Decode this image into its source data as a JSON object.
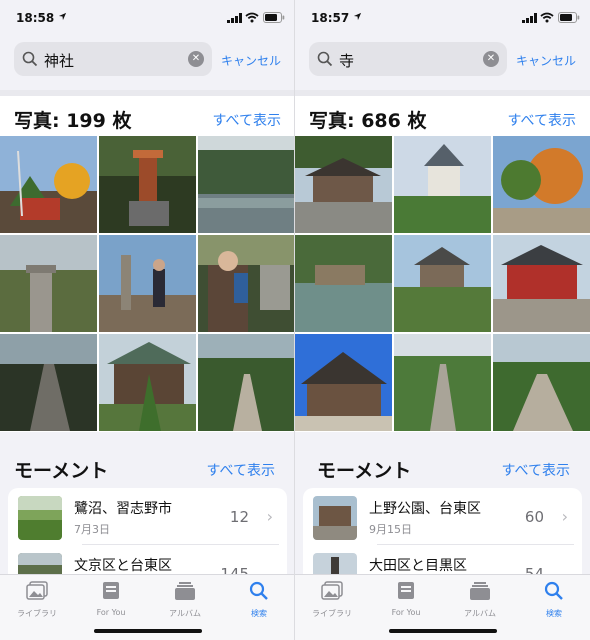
{
  "screens": [
    {
      "status_time": "18:58",
      "search": {
        "query": "神社",
        "cancel_label": "キャンセル"
      },
      "photos": {
        "title": "写真: 199 枚",
        "see_all_label": "すべて表示"
      },
      "moments": {
        "title": "モーメント",
        "see_all_label": "すべて表示",
        "items": [
          {
            "title": "鷺沼、習志野市",
            "date": "7月3日",
            "count": "12"
          },
          {
            "title": "文京区と台東区",
            "date": "",
            "count": "145"
          }
        ]
      }
    },
    {
      "status_time": "18:57",
      "search": {
        "query": "寺",
        "cancel_label": "キャンセル"
      },
      "photos": {
        "title": "写真: 686 枚",
        "see_all_label": "すべて表示"
      },
      "moments": {
        "title": "モーメント",
        "see_all_label": "すべて表示",
        "items": [
          {
            "title": "上野公園、台東区",
            "date": "9月15日",
            "count": "60"
          },
          {
            "title": "大田区と目黒区",
            "date": "",
            "count": "54"
          }
        ]
      }
    }
  ],
  "tabbar": {
    "library": "ライブラリ",
    "for_you": "For You",
    "albums": "アルバム",
    "search": "検索"
  },
  "colors": {
    "accent": "#2f80ed",
    "background": "#f2f2f7"
  },
  "icons": [
    "location-arrow-icon",
    "cellular-signal-icon",
    "wifi-icon",
    "battery-icon",
    "search-icon",
    "clear-icon",
    "chevron-right-icon",
    "photo-library-icon",
    "for-you-icon",
    "albums-icon",
    "search-tab-icon"
  ]
}
